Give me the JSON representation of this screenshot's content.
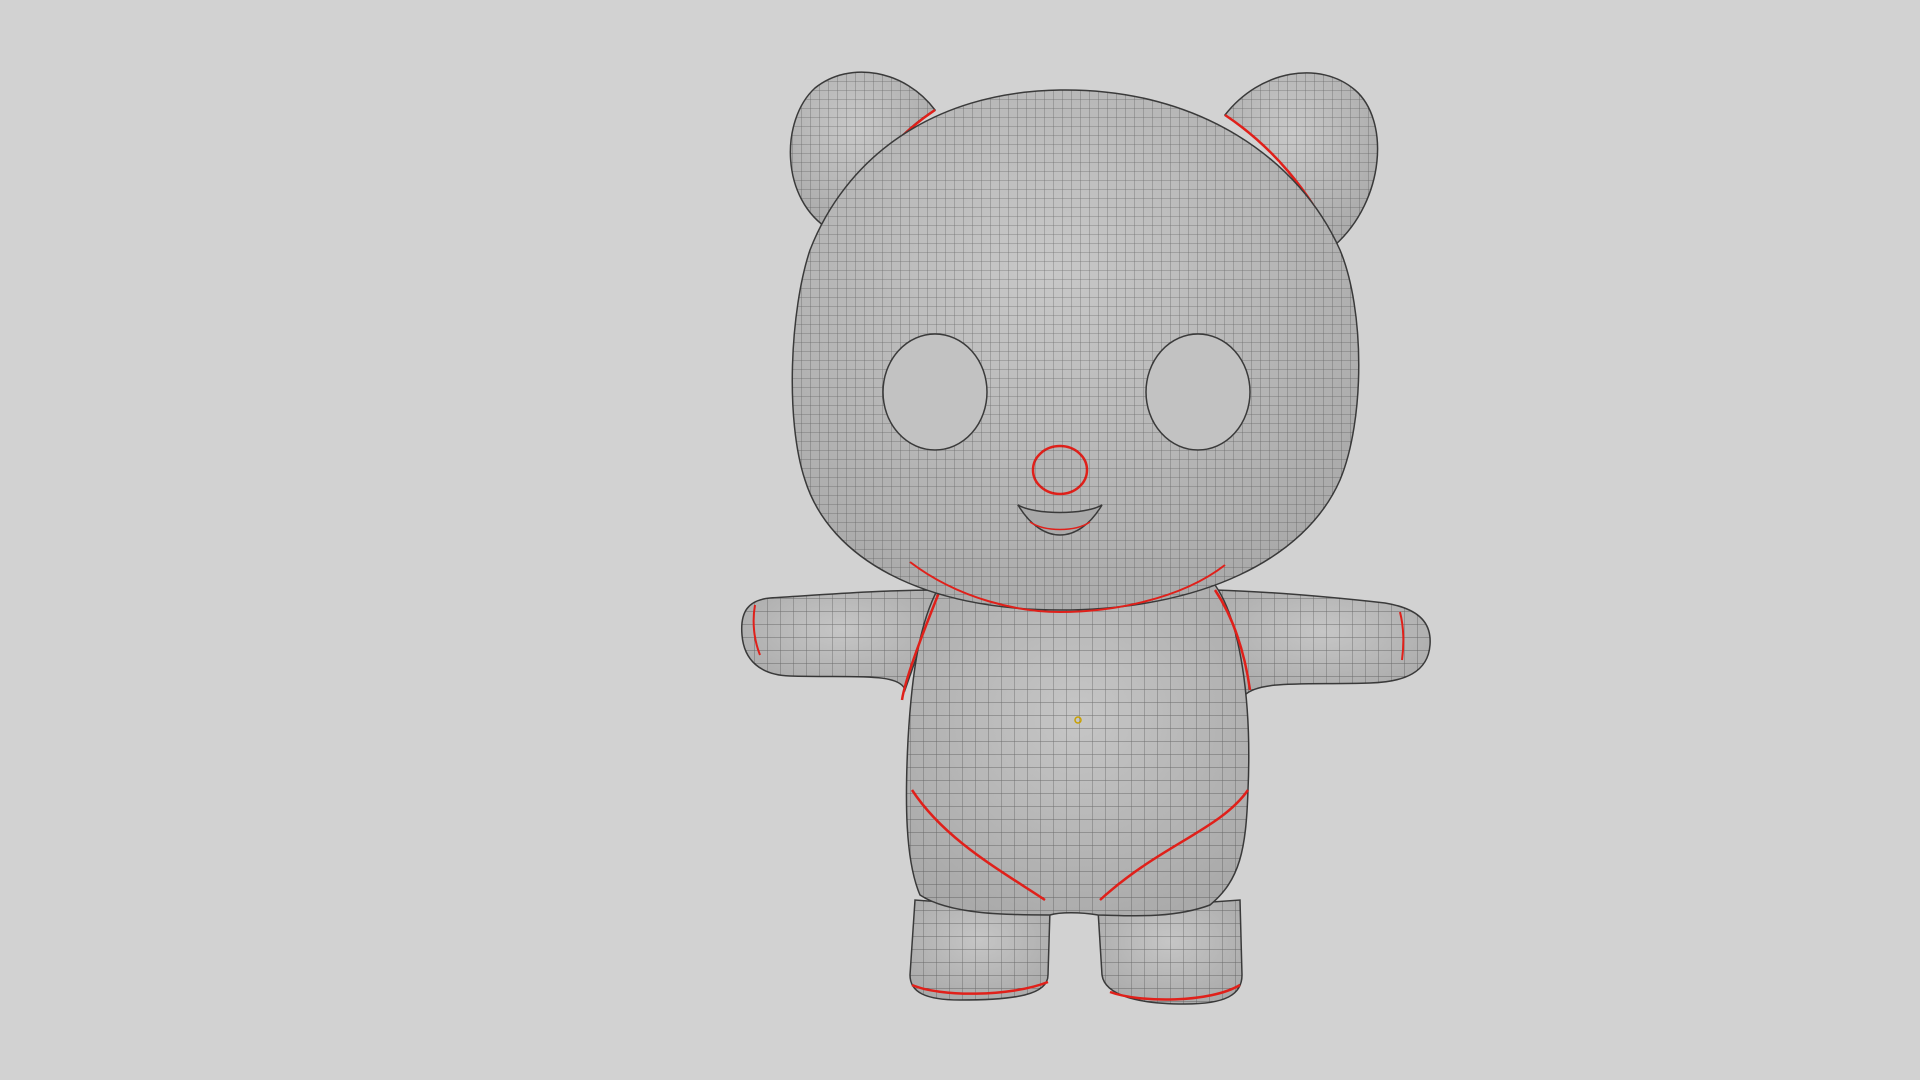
{
  "viewport": {
    "background": "#d2d2d2",
    "mesh_fill": "#bebebe",
    "wire_color": "#2b2b2b",
    "seam_color": "#e0201a",
    "pivot_color": "#c9a000",
    "display_mode": "wireframe-on-shaded"
  },
  "model": {
    "parts": [
      "head",
      "left-ear",
      "right-ear",
      "body",
      "left-arm",
      "right-arm",
      "left-leg",
      "right-leg",
      "nose",
      "mouth",
      "left-eye-socket",
      "right-eye-socket"
    ]
  }
}
